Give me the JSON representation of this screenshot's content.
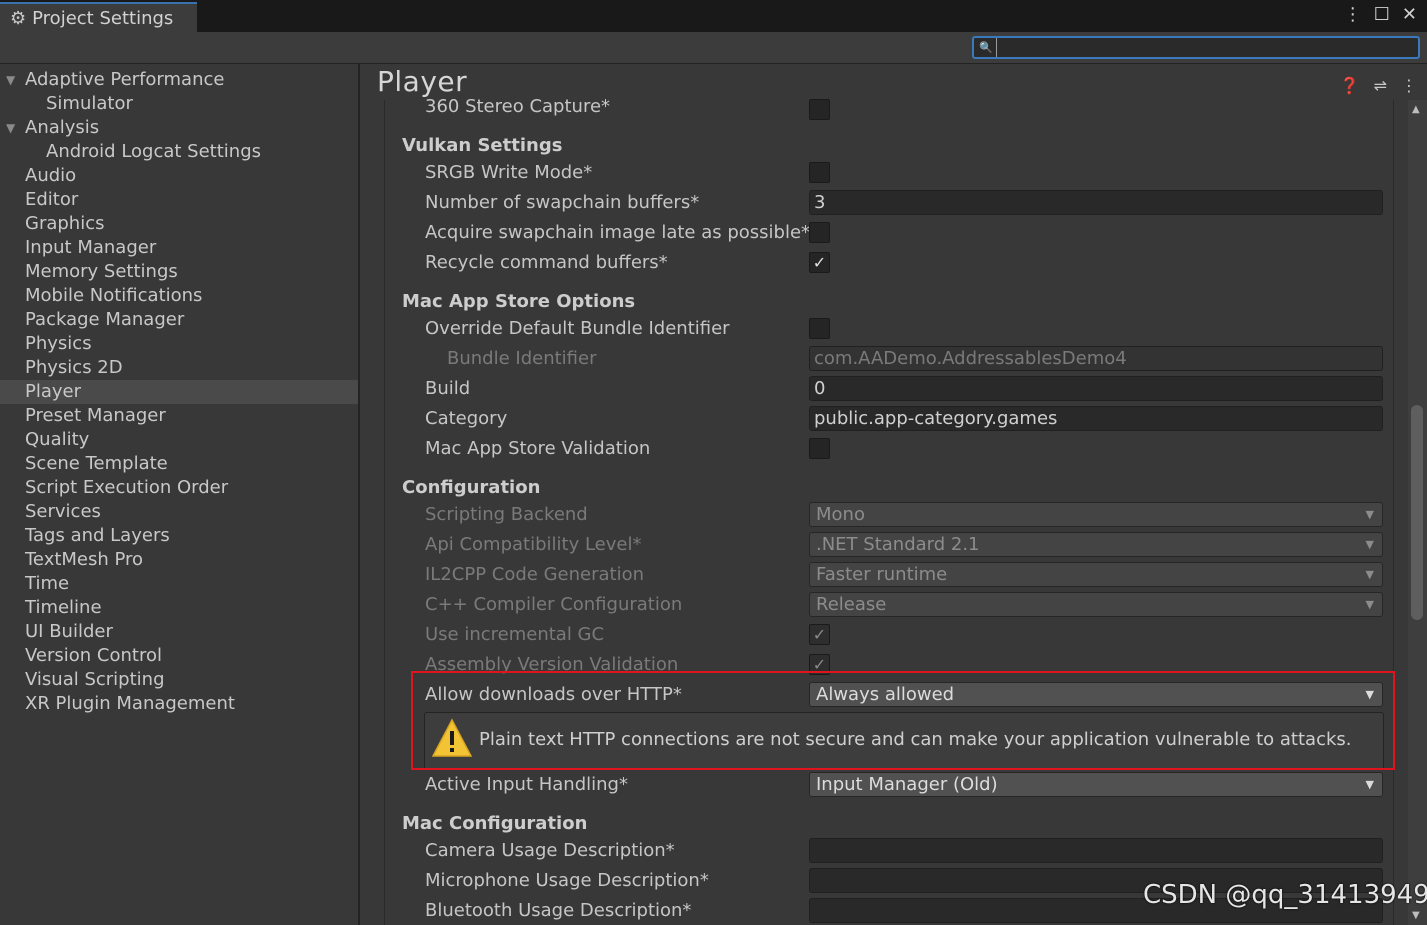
{
  "window": {
    "title": "Project Settings",
    "search": {
      "value": "",
      "placeholder": ""
    }
  },
  "nav": {
    "items": [
      {
        "label": "Adaptive Performance",
        "expanded": true,
        "level": 0
      },
      {
        "label": "Simulator",
        "level": 1
      },
      {
        "label": "Analysis",
        "expanded": true,
        "level": 0
      },
      {
        "label": "Android Logcat Settings",
        "level": 1
      },
      {
        "label": "Audio",
        "level": 0
      },
      {
        "label": "Editor",
        "level": 0
      },
      {
        "label": "Graphics",
        "level": 0
      },
      {
        "label": "Input Manager",
        "level": 0
      },
      {
        "label": "Memory Settings",
        "level": 0
      },
      {
        "label": "Mobile Notifications",
        "level": 0
      },
      {
        "label": "Package Manager",
        "level": 0
      },
      {
        "label": "Physics",
        "level": 0
      },
      {
        "label": "Physics 2D",
        "level": 0
      },
      {
        "label": "Player",
        "level": 0,
        "selected": true
      },
      {
        "label": "Preset Manager",
        "level": 0
      },
      {
        "label": "Quality",
        "level": 0
      },
      {
        "label": "Scene Template",
        "level": 0
      },
      {
        "label": "Script Execution Order",
        "level": 0
      },
      {
        "label": "Services",
        "level": 0
      },
      {
        "label": "Tags and Layers",
        "level": 0
      },
      {
        "label": "TextMesh Pro",
        "level": 0
      },
      {
        "label": "Time",
        "level": 0
      },
      {
        "label": "Timeline",
        "level": 0
      },
      {
        "label": "UI Builder",
        "level": 0
      },
      {
        "label": "Version Control",
        "level": 0
      },
      {
        "label": "Visual Scripting",
        "level": 0
      },
      {
        "label": "XR Plugin Management",
        "level": 0
      }
    ]
  },
  "main": {
    "title": "Player",
    "stereo_capture": {
      "label": "360 Stereo Capture*",
      "checked": false
    },
    "vulkan": {
      "heading": "Vulkan Settings",
      "srgb_label": "SRGB Write Mode*",
      "srgb_checked": false,
      "swapchain_label": "Number of swapchain buffers*",
      "swapchain_value": "3",
      "acquire_label": "Acquire swapchain image late as possible*",
      "acquire_checked": false,
      "recycle_label": "Recycle command buffers*",
      "recycle_checked": true
    },
    "mac_store": {
      "heading": "Mac App Store Options",
      "override_label": "Override Default Bundle Identifier",
      "override_checked": false,
      "bundle_label": "Bundle Identifier",
      "bundle_value": "com.AADemo.AddressablesDemo4",
      "build_label": "Build",
      "build_value": "0",
      "category_label": "Category",
      "category_value": "public.app-category.games",
      "validation_label": "Mac App Store Validation",
      "validation_checked": false
    },
    "configuration": {
      "heading": "Configuration",
      "backend_label": "Scripting Backend",
      "backend_value": "Mono",
      "api_label": "Api Compatibility Level*",
      "api_value": ".NET Standard 2.1",
      "il2cpp_label": "IL2CPP Code Generation",
      "il2cpp_value": "Faster runtime",
      "cpp_label": "C++ Compiler Configuration",
      "cpp_value": "Release",
      "gc_label": "Use incremental GC",
      "gc_checked": true,
      "assembly_label": "Assembly Version Validation",
      "assembly_checked": true,
      "http_label": "Allow downloads over HTTP*",
      "http_value": "Always allowed",
      "warning_text": "Plain text HTTP connections are not secure and can make your application vulnerable to attacks.",
      "input_label": "Active Input Handling*",
      "input_value": "Input Manager (Old)"
    },
    "mac_config": {
      "heading": "Mac Configuration",
      "camera_label": "Camera Usage Description*",
      "camera_value": "",
      "mic_label": "Microphone Usage Description*",
      "mic_value": "",
      "bt_label": "Bluetooth Usage Description*",
      "bt_value": ""
    }
  },
  "highlight_color": "#e0141e",
  "accent_color": "#3a79bb",
  "watermark": "CSDN @qq_31413949"
}
